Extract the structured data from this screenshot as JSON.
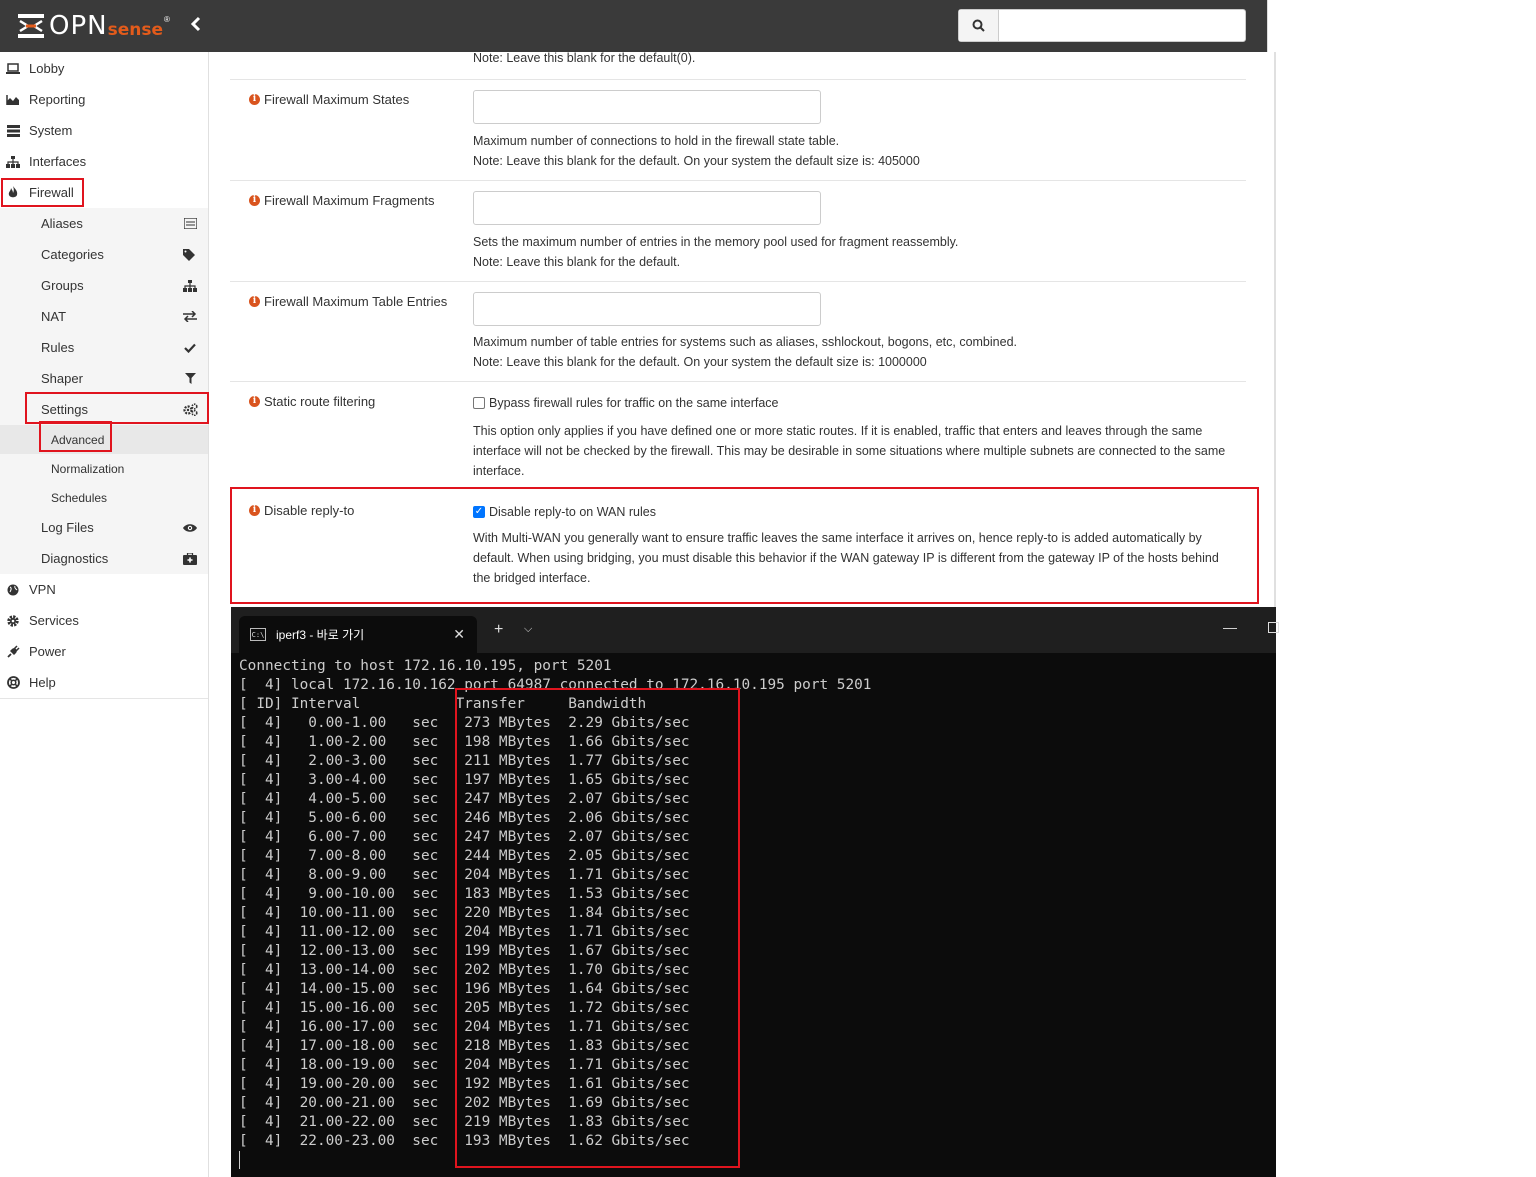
{
  "header": {
    "logo_opn": "OPN",
    "logo_sense": "sense",
    "logo_reg": "®",
    "collapse_icon": "chevron-left",
    "search_placeholder": ""
  },
  "sidebar": {
    "top": [
      {
        "label": "Lobby",
        "icon": "laptop-icon"
      },
      {
        "label": "Reporting",
        "icon": "area-chart-icon"
      },
      {
        "label": "System",
        "icon": "server-icon"
      },
      {
        "label": "Interfaces",
        "icon": "sitemap-icon"
      },
      {
        "label": "Firewall",
        "icon": "fire-icon"
      }
    ],
    "firewall_sub": [
      {
        "label": "Aliases",
        "icon": "list-icon"
      },
      {
        "label": "Categories",
        "icon": "tags-icon"
      },
      {
        "label": "Groups",
        "icon": "sitemap-icon"
      },
      {
        "label": "NAT",
        "icon": "exchange-icon"
      },
      {
        "label": "Rules",
        "icon": "check-icon"
      },
      {
        "label": "Shaper",
        "icon": "filter-icon"
      },
      {
        "label": "Settings",
        "icon": "cogs-icon"
      }
    ],
    "settings_sub": [
      "Advanced",
      "Normalization",
      "Schedules"
    ],
    "firewall_sub2": [
      {
        "label": "Log Files",
        "icon": "eye-icon"
      },
      {
        "label": "Diagnostics",
        "icon": "medkit-icon"
      }
    ],
    "bottom": [
      {
        "label": "VPN",
        "icon": "globe-icon"
      },
      {
        "label": "Services",
        "icon": "cog-icon"
      },
      {
        "label": "Power",
        "icon": "plug-icon"
      },
      {
        "label": "Help",
        "icon": "lifebuoy-icon"
      }
    ]
  },
  "content": {
    "top_note": "Note: Leave this blank for the default(0).",
    "rows": {
      "max_states": {
        "label": "Firewall Maximum States",
        "value": "",
        "help1": "Maximum number of connections to hold in the firewall state table.",
        "help2": "Note: Leave this blank for the default. On your system the default size is: 405000"
      },
      "max_fragments": {
        "label": "Firewall Maximum Fragments",
        "value": "",
        "help1": "Sets the maximum number of entries in the memory pool used for fragment reassembly.",
        "help2": "Note: Leave this blank for the default."
      },
      "max_table": {
        "label": "Firewall Maximum Table Entries",
        "value": "",
        "help1": "Maximum number of table entries for systems such as aliases, sshlockout, bogons, etc, combined.",
        "help2": "Note: Leave this blank for the default. On your system the default size is: 1000000"
      },
      "static_route": {
        "label": "Static route filtering",
        "checkbox": "Bypass firewall rules for traffic on the same interface",
        "checked": false,
        "help": "This option only applies if you have defined one or more static routes. If it is enabled, traffic that enters and leaves through the same interface will not be checked by the firewall. This may be desirable in some situations where multiple subnets are connected to the same interface."
      },
      "reply_to": {
        "label": "Disable reply-to",
        "checkbox": "Disable reply-to on WAN rules",
        "checked": true,
        "help": "With Multi-WAN you generally want to ensure traffic leaves the same interface it arrives on, hence reply-to is added automatically by default. When using bridging, you must disable this behavior if the WAN gateway IP is different from the gateway IP of the hosts behind the bridged interface."
      }
    }
  },
  "terminal": {
    "tab_title": "iperf3 - 바로 가기",
    "lines": [
      "Connecting to host 172.16.10.195, port 5201",
      "[  4] local 172.16.10.162 port 64987 connected to 172.16.10.195 port 5201",
      "[ ID] Interval           Transfer     Bandwidth",
      "[  4]   0.00-1.00   sec   273 MBytes  2.29 Gbits/sec",
      "[  4]   1.00-2.00   sec   198 MBytes  1.66 Gbits/sec",
      "[  4]   2.00-3.00   sec   211 MBytes  1.77 Gbits/sec",
      "[  4]   3.00-4.00   sec   197 MBytes  1.65 Gbits/sec",
      "[  4]   4.00-5.00   sec   247 MBytes  2.07 Gbits/sec",
      "[  4]   5.00-6.00   sec   246 MBytes  2.06 Gbits/sec",
      "[  4]   6.00-7.00   sec   247 MBytes  2.07 Gbits/sec",
      "[  4]   7.00-8.00   sec   244 MBytes  2.05 Gbits/sec",
      "[  4]   8.00-9.00   sec   204 MBytes  1.71 Gbits/sec",
      "[  4]   9.00-10.00  sec   183 MBytes  1.53 Gbits/sec",
      "[  4]  10.00-11.00  sec   220 MBytes  1.84 Gbits/sec",
      "[  4]  11.00-12.00  sec   204 MBytes  1.71 Gbits/sec",
      "[  4]  12.00-13.00  sec   199 MBytes  1.67 Gbits/sec",
      "[  4]  13.00-14.00  sec   202 MBytes  1.70 Gbits/sec",
      "[  4]  14.00-15.00  sec   196 MBytes  1.64 Gbits/sec",
      "[  4]  15.00-16.00  sec   205 MBytes  1.72 Gbits/sec",
      "[  4]  16.00-17.00  sec   204 MBytes  1.71 Gbits/sec",
      "[  4]  17.00-18.00  sec   218 MBytes  1.83 Gbits/sec",
      "[  4]  18.00-19.00  sec   204 MBytes  1.71 Gbits/sec",
      "[  4]  19.00-20.00  sec   192 MBytes  1.61 Gbits/sec",
      "[  4]  20.00-21.00  sec   202 MBytes  1.69 Gbits/sec",
      "[  4]  21.00-22.00  sec   219 MBytes  1.83 Gbits/sec",
      "[  4]  22.00-23.00  sec   193 MBytes  1.62 Gbits/sec"
    ]
  },
  "colors": {
    "header_bg": "#3a3a3a",
    "accent": "#e35b1b",
    "info_icon": "#d9541e",
    "callout": "#e0141e",
    "terminal_bg": "#0c0c0c",
    "terminal_text": "#cccccc"
  }
}
